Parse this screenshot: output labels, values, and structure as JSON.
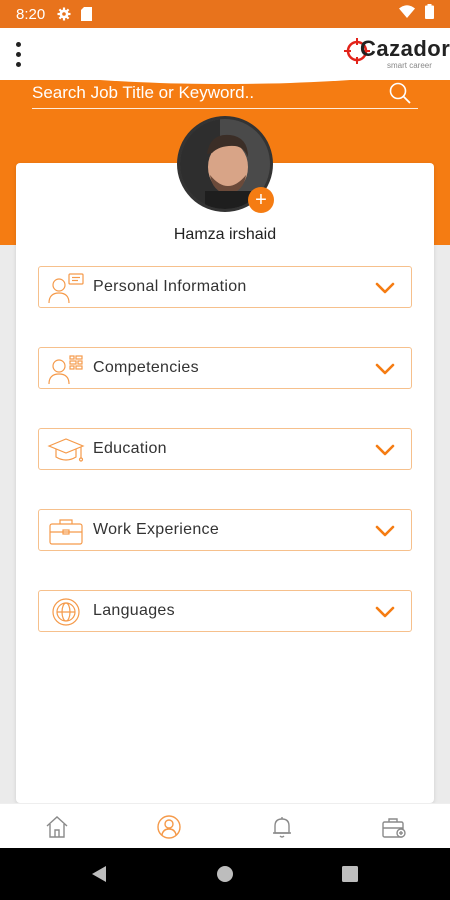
{
  "status": {
    "time": "8:20"
  },
  "brand": {
    "name": "Cazador",
    "tagline": "smart career"
  },
  "search": {
    "placeholder": "Search Job Title or Keyword.."
  },
  "profile": {
    "name": "Hamza irshaid",
    "add_label": "+"
  },
  "sections": [
    {
      "label": "Personal Information",
      "icon": "person-id-icon"
    },
    {
      "label": "Competencies",
      "icon": "person-skills-icon"
    },
    {
      "label": "Education",
      "icon": "graduation-cap-icon"
    },
    {
      "label": "Work Experience",
      "icon": "briefcase-icon"
    },
    {
      "label": "Languages",
      "icon": "globe-icon"
    }
  ],
  "bottom_nav": [
    "home-icon",
    "profile-icon",
    "bell-icon",
    "jobs-icon"
  ],
  "colors": {
    "accent": "#f57c12",
    "statusbar": "#e8731c",
    "border": "#f6c08c",
    "nav_inactive": "#8a8a8a"
  }
}
